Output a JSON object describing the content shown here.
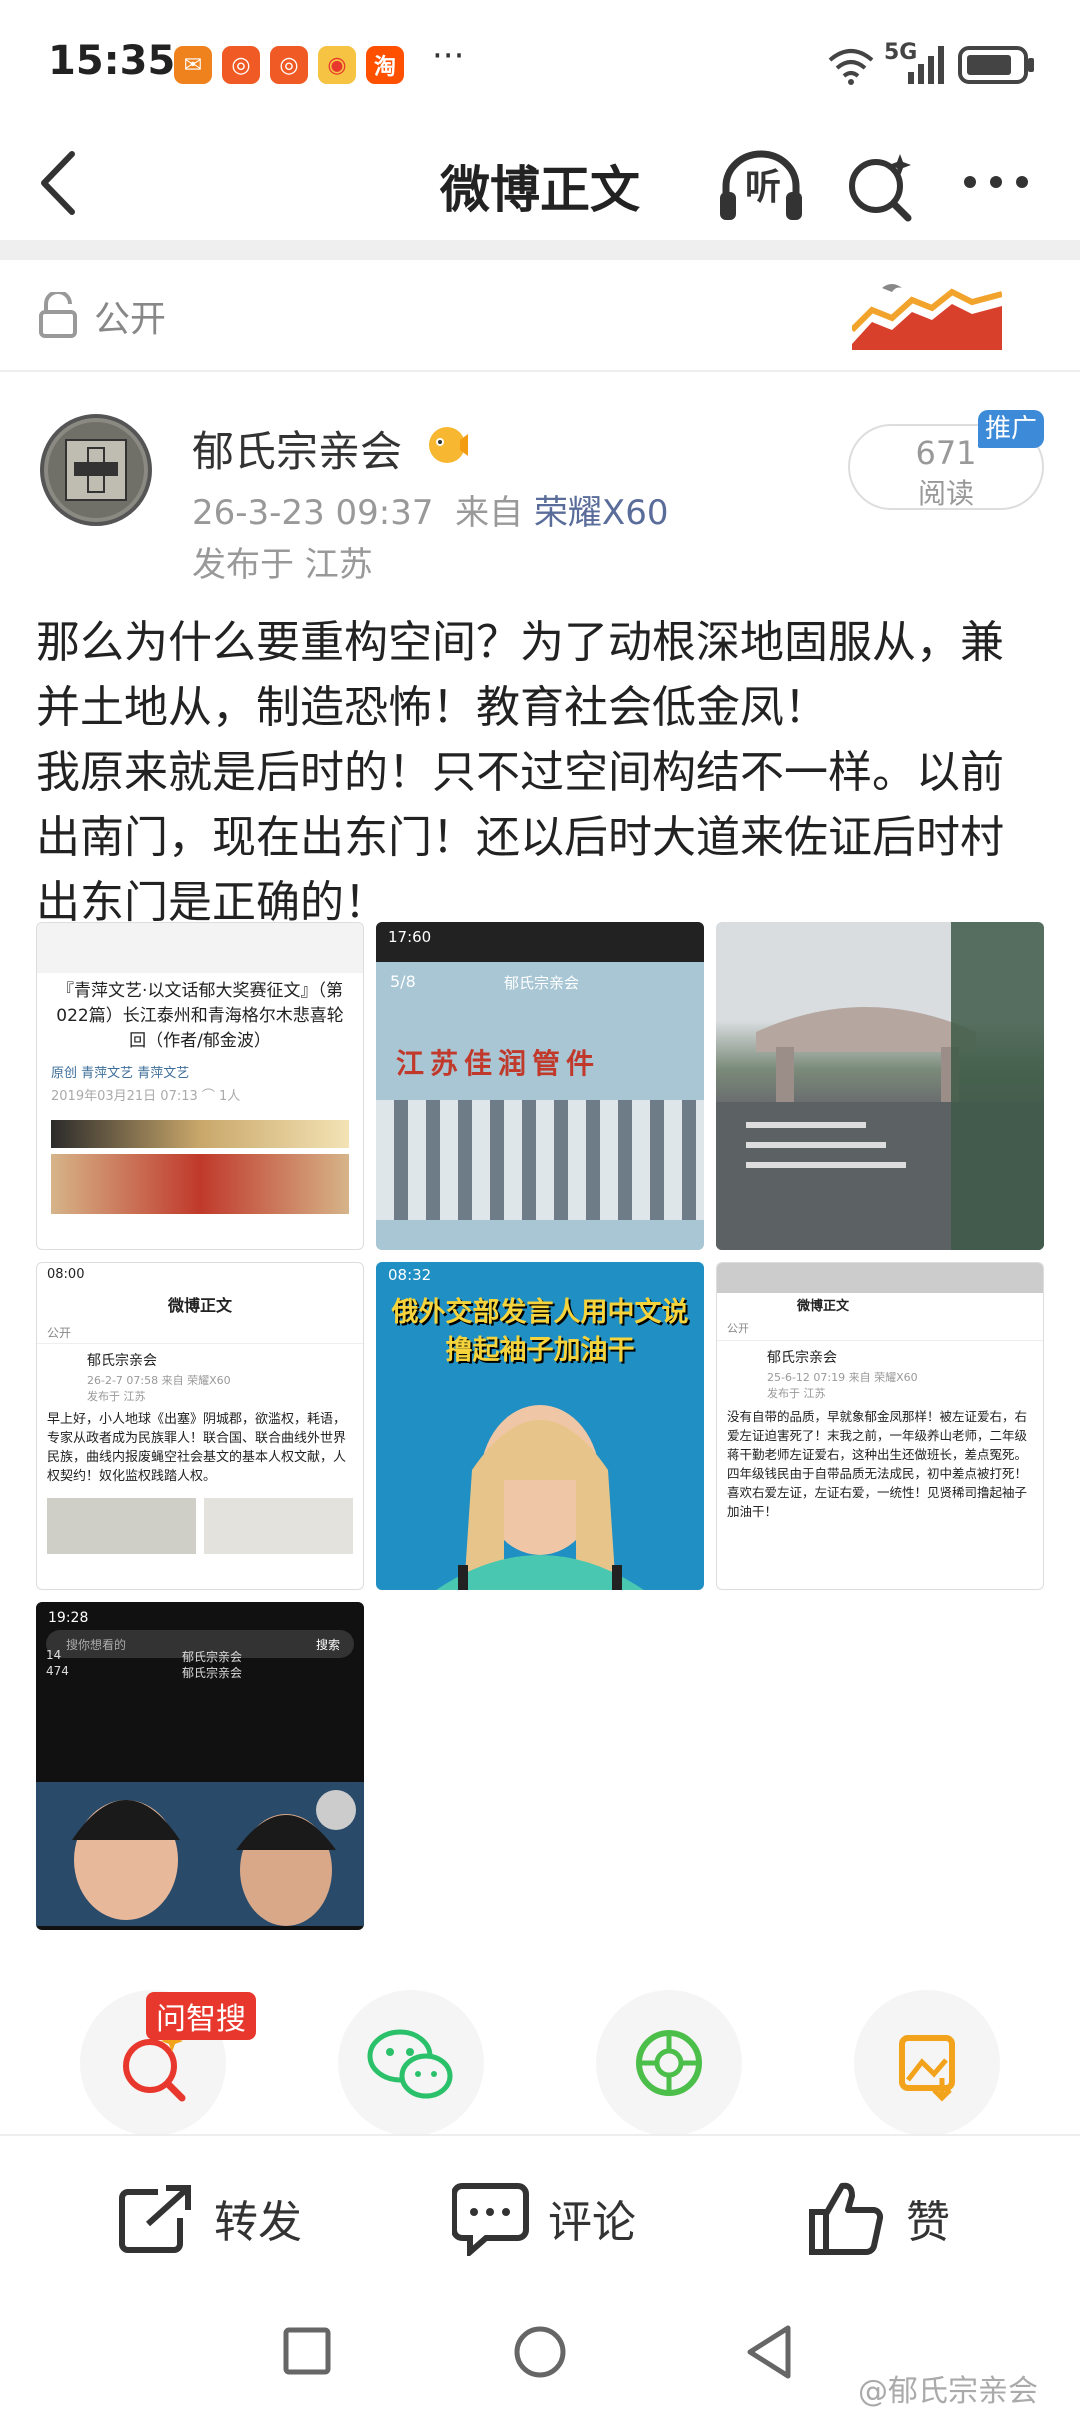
{
  "status_bar": {
    "time": "15:35",
    "network": "5G",
    "icons": [
      "wechat-red-icon",
      "ketou-icon",
      "ketou-icon",
      "weibo-icon",
      "taobao-icon"
    ],
    "taobao_label": "淘",
    "more": "···"
  },
  "nav": {
    "title": "微博正文",
    "listen_label": "听"
  },
  "visibility": {
    "label": "公开"
  },
  "post": {
    "author": "郁氏宗亲会",
    "date": "26-3-23 09:37",
    "from_prefix": "来自",
    "device": "荣耀X60",
    "location": "发布于 江苏",
    "read_count": "671",
    "read_label": "阅读",
    "ad_badge": "推广",
    "paragraphs": [
      "那么为什么要重构空间？为了动根深地固服从，兼并土地从，制造恐怖！教育社会低金凤！",
      "我原来就是后时的！只不过空间构结不一样。以前出南门，现在出东门！还以后时大道来佐证后时村出东门是正确的！"
    ]
  },
  "thumbs": {
    "t1": {
      "title": "『青萍文艺·以文话郁大奖赛征文』（第022篇）长江泰州和青海格尔木悲喜轮回（作者/郁金波）",
      "sub": "原创  青萍文艺  青萍文艺",
      "date": "2019年03月21日 07:13  ⌒ 1人"
    },
    "t2": {
      "time": "17:60",
      "page": "5/8",
      "name": "郁氏宗亲会",
      "sign": "江苏佳润管件"
    },
    "t4": {
      "time": "08:00",
      "title": "微博正文",
      "public": "公开",
      "name": "郁氏宗亲会",
      "meta": "26-2-7 07:58 来自 荣耀X60",
      "loc": "发布于 江苏",
      "text": "早上好，小人地球《出塞》阴城郡，欲滥权，耗语，专家从政者成为民族罪人！联合国、联合曲线外世界民族，曲线内报废蝇空社会基文的基本人权文献，人权契约！奴化监权践踏人权。"
    },
    "t5": {
      "time": "08:32",
      "caption": "俄外交部发言人用中文说撸起袖子加油干"
    },
    "t6": {
      "name": "郁氏宗亲会",
      "title": "微博正文",
      "public": "公开",
      "meta": "25-6-12 07:19 来自 荣耀X60",
      "loc": "发布于 江苏",
      "text": "没有自带的品质，早就象郁金凤那样！被左证爱右，右爱左证迫害死了！末我之前，一年级养山老师，二年级蒋干勤老师左证爱右，这种出生还做班长，差点冤死。四年级钱民由于自带品质无法成民，初中差点被打死！喜欢右爱左证，左证右爱，一统性！见贤稀司撸起袖子加油干！"
    },
    "t7": {
      "time": "19:28",
      "search": "搜你想看的",
      "name1": "郁氏宗亲会",
      "name2": "郁氏宗亲会",
      "count1": "14",
      "count2": "474",
      "btn": "搜索"
    }
  },
  "actions": {
    "ai_search_badge": "问智搜"
  },
  "bottom_bar": {
    "repost": "转发",
    "comment": "评论",
    "like": "赞"
  },
  "watermark": "@郁氏宗亲会",
  "colors": {
    "accent_red": "#e8382d",
    "link_blue": "#5a6c9a",
    "wechat_green": "#2bc06a",
    "camera_green": "#4cbf4a",
    "gallery_orange": "#f3a21b",
    "ad_blue": "#3c8ad8"
  }
}
